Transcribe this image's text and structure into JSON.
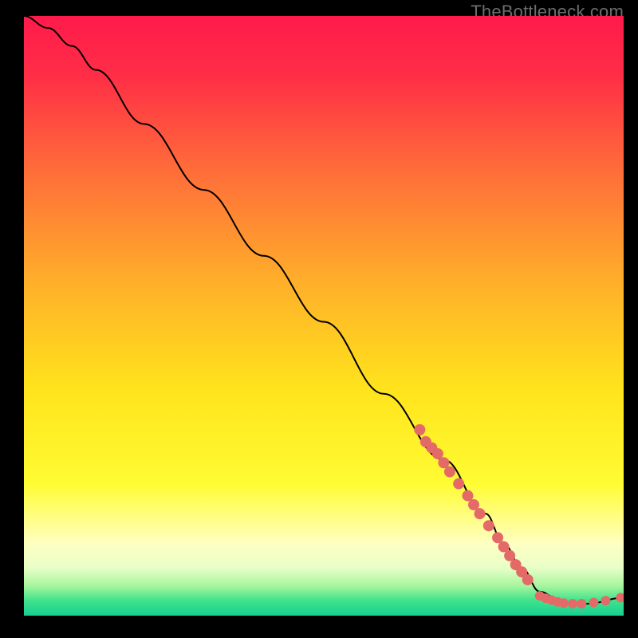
{
  "attribution": "TheBottleneck.com",
  "chart_data": {
    "type": "line",
    "title": "",
    "xlabel": "",
    "ylabel": "",
    "xlim": [
      0,
      100
    ],
    "ylim": [
      0,
      100
    ],
    "grid": false,
    "legend": false,
    "background_gradient": {
      "stops": [
        {
          "pos": 0.0,
          "color": "#ff1a4b"
        },
        {
          "pos": 0.1,
          "color": "#ff2e46"
        },
        {
          "pos": 0.25,
          "color": "#ff6a3a"
        },
        {
          "pos": 0.45,
          "color": "#ffb129"
        },
        {
          "pos": 0.62,
          "color": "#ffe31c"
        },
        {
          "pos": 0.78,
          "color": "#fffc33"
        },
        {
          "pos": 0.88,
          "color": "#ffffc2"
        },
        {
          "pos": 0.92,
          "color": "#e8ffc8"
        },
        {
          "pos": 0.95,
          "color": "#a8f59e"
        },
        {
          "pos": 0.975,
          "color": "#3fe28a"
        },
        {
          "pos": 1.0,
          "color": "#17d093"
        }
      ]
    },
    "series": [
      {
        "name": "bottleneck-curve",
        "color": "#000000",
        "stroke_width": 2,
        "x": [
          0,
          4,
          8,
          12,
          20,
          30,
          40,
          50,
          60,
          70,
          77,
          80,
          83,
          86,
          90,
          94,
          100
        ],
        "y": [
          100,
          98,
          95,
          91,
          82,
          71,
          60,
          49,
          37,
          26,
          17,
          12,
          8,
          4,
          2,
          2,
          3
        ]
      }
    ],
    "marker_clusters": [
      {
        "name": "steep-segment-markers",
        "color": "#e46a68",
        "radius": 7,
        "points": [
          {
            "x": 66,
            "y": 31
          },
          {
            "x": 67,
            "y": 29
          },
          {
            "x": 68,
            "y": 28
          },
          {
            "x": 69,
            "y": 27
          },
          {
            "x": 70,
            "y": 25.5
          },
          {
            "x": 71,
            "y": 24
          },
          {
            "x": 72.5,
            "y": 22
          },
          {
            "x": 74,
            "y": 20
          },
          {
            "x": 75,
            "y": 18.5
          },
          {
            "x": 76,
            "y": 17
          },
          {
            "x": 77.5,
            "y": 15
          },
          {
            "x": 79,
            "y": 13
          },
          {
            "x": 80,
            "y": 11.5
          },
          {
            "x": 81,
            "y": 10
          },
          {
            "x": 82,
            "y": 8.5
          },
          {
            "x": 83,
            "y": 7.3
          },
          {
            "x": 84,
            "y": 6
          }
        ]
      },
      {
        "name": "flat-segment-markers",
        "color": "#e46a68",
        "radius": 6,
        "points": [
          {
            "x": 86,
            "y": 3.3
          },
          {
            "x": 87,
            "y": 2.9
          },
          {
            "x": 88,
            "y": 2.6
          },
          {
            "x": 89,
            "y": 2.3
          },
          {
            "x": 90,
            "y": 2.1
          },
          {
            "x": 91.5,
            "y": 2.0
          },
          {
            "x": 93,
            "y": 2.0
          },
          {
            "x": 95,
            "y": 2.2
          },
          {
            "x": 97,
            "y": 2.5
          },
          {
            "x": 99.5,
            "y": 3.0
          }
        ]
      }
    ]
  }
}
